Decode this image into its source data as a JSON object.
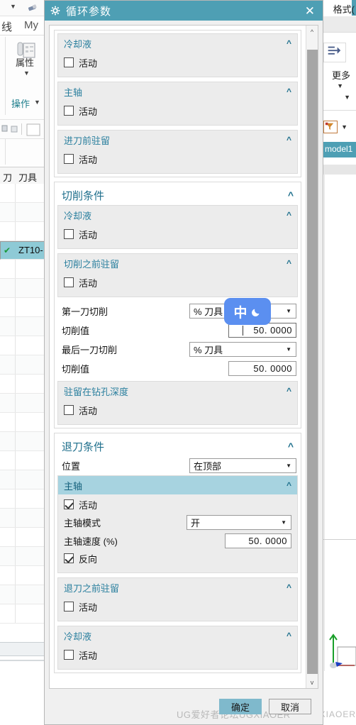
{
  "dialog": {
    "title": "循环参数",
    "gear_icon": "gear-icon",
    "close_icon": "close-icon",
    "collapse_caret": "^",
    "dropdown_caret": "▼",
    "scroll_up_icon": "^",
    "scroll_down_icon": "v",
    "accent_color": "#4e9fb4",
    "header_text_color": "#2a7f9e",
    "highlight_color": "#a7d3e0"
  },
  "top_groups": [
    {
      "title": "冷却液",
      "checkbox_label": "活动",
      "checked": false
    },
    {
      "title": "主轴",
      "checkbox_label": "活动",
      "checked": false
    },
    {
      "title": "进刀前驻留",
      "checkbox_label": "活动",
      "checked": false
    }
  ],
  "cutting": {
    "title": "切削条件",
    "subs": [
      {
        "title": "冷却液",
        "checkbox_label": "活动",
        "checked": false
      },
      {
        "title": "切削之前驻留",
        "checkbox_label": "活动",
        "checked": false
      }
    ],
    "fields": {
      "first_cut_label": "第一刀切削",
      "first_cut_value": "% 刀具",
      "first_cut_amount_label": "切削值",
      "first_cut_amount": "50. 0000",
      "last_cut_label": "最后一刀切削",
      "last_cut_value": "% 刀具",
      "last_cut_amount_label": "切削值",
      "last_cut_amount": "50. 0000"
    },
    "dwell_group": {
      "title": "驻留在钻孔深度",
      "checkbox_label": "活动",
      "checked": false
    }
  },
  "retract": {
    "title": "退刀条件",
    "position_label": "位置",
    "position_value": "在顶部",
    "spindle": {
      "title": "主轴",
      "highlighted": true,
      "active_label": "活动",
      "active_checked": true,
      "mode_label": "主轴模式",
      "mode_value": "开",
      "speed_label": "主轴速度 (%)",
      "speed_value": "50. 0000",
      "reverse_label": "反向",
      "reverse_checked": true
    },
    "subs": [
      {
        "title": "退刀之前驻留",
        "checkbox_label": "活动",
        "checked": false
      },
      {
        "title": "冷却液",
        "checkbox_label": "活动",
        "checked": false
      }
    ]
  },
  "footer": {
    "ok_label": "确定",
    "cancel_label": "取消",
    "watermark": "UG爱好者论坛UGXIAOER"
  },
  "ime": {
    "mode": "中",
    "moon_icon": "moon-icon"
  },
  "background": {
    "left": {
      "tab_label": "线",
      "tab_label2": "My",
      "properties_label": "属性",
      "operation_label": "操作",
      "col_header_1": "刀",
      "col_header_2": "刀具",
      "selected_row": "ZT10-"
    },
    "right": {
      "format_label": "格式(",
      "more_label": "更多",
      "model_tab": "model1",
      "watermark": "XIAOER"
    }
  }
}
